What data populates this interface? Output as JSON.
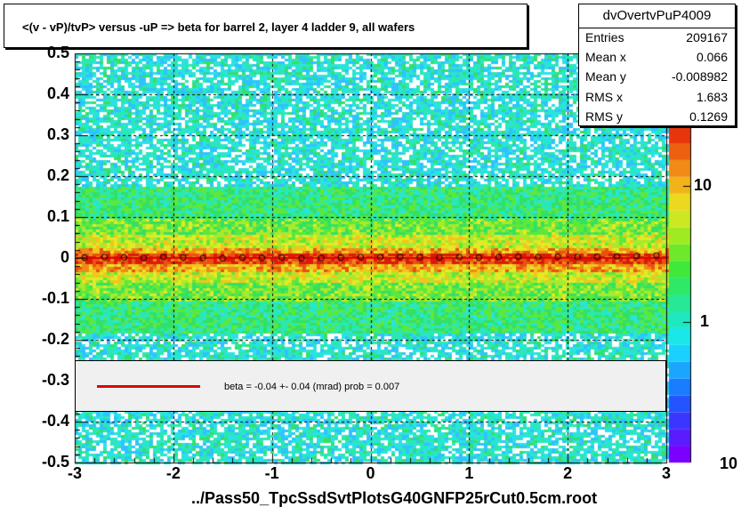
{
  "chart_data": {
    "type": "heatmap",
    "title": "<(v - vP)/tvP> versus  -uP => beta for barrel 2, layer 4 ladder 9, all wafers",
    "xlabel": "../Pass50_TpcSsdSvtPlotsG40GNFP25rCut0.5cm.root",
    "ylabel": "",
    "xlim": [
      -3,
      3
    ],
    "ylim": [
      -0.5,
      0.5
    ],
    "x_ticks": [
      "-3",
      "-2",
      "-1",
      "0",
      "1",
      "2",
      "3"
    ],
    "y_ticks": [
      "-0.5",
      "-0.4",
      "-0.3",
      "-0.2",
      "-0.1",
      "0",
      "0.1",
      "0.2",
      "0.3",
      "0.4",
      "0.5"
    ],
    "z_scale": "log",
    "z_ticks": [
      "1",
      "10"
    ],
    "z_top_label": "10",
    "grid": true,
    "profile_points": {
      "x": [
        -2.9,
        -2.7,
        -2.5,
        -2.3,
        -2.1,
        -1.9,
        -1.7,
        -1.5,
        -1.3,
        -1.1,
        -0.9,
        -0.7,
        -0.5,
        -0.3,
        -0.1,
        0.1,
        0.3,
        0.5,
        0.7,
        0.9,
        1.1,
        1.3,
        1.5,
        1.7,
        1.9,
        2.1,
        2.3,
        2.5,
        2.7,
        2.9
      ],
      "y": [
        0.001,
        0.002,
        0.001,
        0.0,
        0.002,
        0.001,
        0.0,
        -0.001,
        0.001,
        0.0,
        0.001,
        -0.001,
        0.0,
        0.001,
        0.002,
        0.002,
        0.003,
        0.002,
        0.001,
        0.002,
        0.001,
        0.002,
        0.003,
        0.002,
        0.003,
        0.002,
        0.003,
        0.004,
        0.005,
        0.006
      ]
    },
    "fit_line_y": 0.0,
    "fit_text": "beta =   -0.04 +-  0.04 (mrad) prob = 0.007"
  },
  "stats": {
    "name": "dvOvertvPuP4009",
    "rows": [
      {
        "key": "Entries",
        "value": "209167"
      },
      {
        "key": "Mean x",
        "value": "0.066"
      },
      {
        "key": "Mean y",
        "value": "-0.008982"
      },
      {
        "key": "RMS x",
        "value": "1.683"
      },
      {
        "key": "RMS y",
        "value": "0.1269"
      }
    ]
  }
}
